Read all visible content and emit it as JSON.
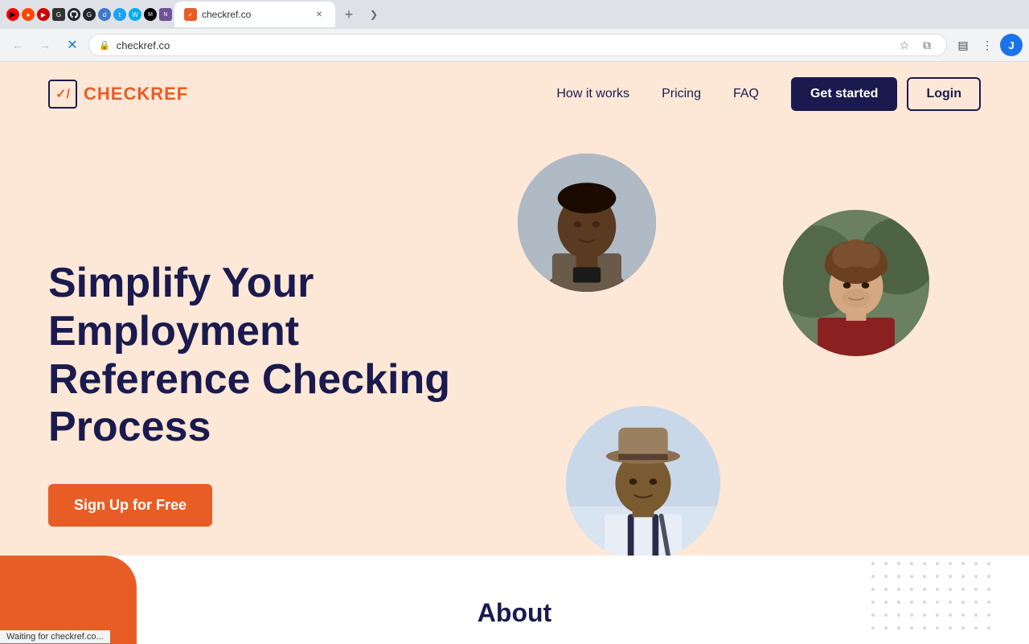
{
  "browser": {
    "active_tab_title": "checkref.co",
    "url": "checkref.co",
    "loading": true,
    "status_text": "Waiting for checkref.co...",
    "close_icon": "✕",
    "new_tab_icon": "+",
    "expand_icon": "❯",
    "back_icon": "←",
    "forward_icon": "→",
    "reload_icon": "✕",
    "lock_icon": "🔒",
    "star_icon": "☆",
    "extensions_icon": "⧉",
    "sidebar_icon": "▤",
    "profile_letter": "J",
    "menu_icon": "⋮"
  },
  "navbar": {
    "logo_icon": "✓/",
    "logo_check": "CHECK",
    "logo_ref": "REF",
    "nav_items": [
      {
        "label": "How it works"
      },
      {
        "label": "Pricing"
      },
      {
        "label": "FAQ"
      }
    ],
    "get_started_label": "Get started",
    "login_label": "Login"
  },
  "hero": {
    "title": "Simplify Your Employment Reference Checking Process",
    "cta_label": "Sign Up for Free"
  },
  "about": {
    "heading": "About"
  },
  "colors": {
    "bg": "#fde8d8",
    "accent_orange": "#e85d26",
    "dark_navy": "#1a1a4e",
    "white": "#ffffff"
  }
}
